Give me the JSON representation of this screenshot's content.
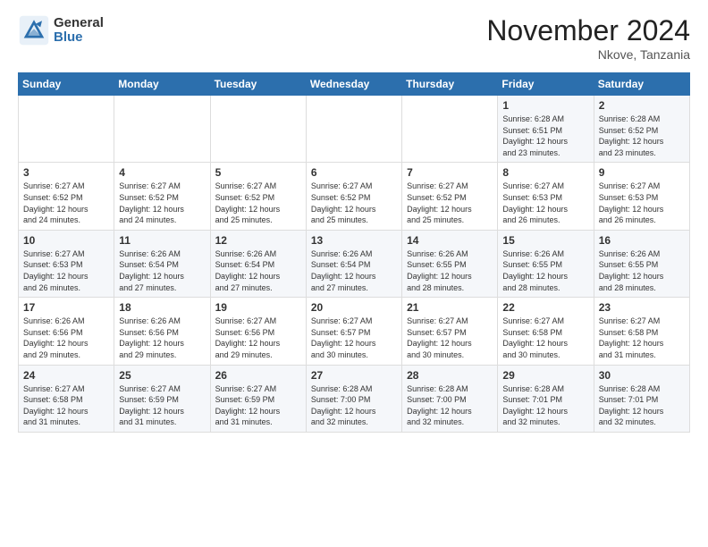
{
  "logo": {
    "general": "General",
    "blue": "Blue"
  },
  "header": {
    "month": "November 2024",
    "location": "Nkove, Tanzania"
  },
  "weekdays": [
    "Sunday",
    "Monday",
    "Tuesday",
    "Wednesday",
    "Thursday",
    "Friday",
    "Saturday"
  ],
  "weeks": [
    [
      {
        "day": "",
        "info": ""
      },
      {
        "day": "",
        "info": ""
      },
      {
        "day": "",
        "info": ""
      },
      {
        "day": "",
        "info": ""
      },
      {
        "day": "",
        "info": ""
      },
      {
        "day": "1",
        "info": "Sunrise: 6:28 AM\nSunset: 6:51 PM\nDaylight: 12 hours\nand 23 minutes."
      },
      {
        "day": "2",
        "info": "Sunrise: 6:28 AM\nSunset: 6:52 PM\nDaylight: 12 hours\nand 23 minutes."
      }
    ],
    [
      {
        "day": "3",
        "info": "Sunrise: 6:27 AM\nSunset: 6:52 PM\nDaylight: 12 hours\nand 24 minutes."
      },
      {
        "day": "4",
        "info": "Sunrise: 6:27 AM\nSunset: 6:52 PM\nDaylight: 12 hours\nand 24 minutes."
      },
      {
        "day": "5",
        "info": "Sunrise: 6:27 AM\nSunset: 6:52 PM\nDaylight: 12 hours\nand 25 minutes."
      },
      {
        "day": "6",
        "info": "Sunrise: 6:27 AM\nSunset: 6:52 PM\nDaylight: 12 hours\nand 25 minutes."
      },
      {
        "day": "7",
        "info": "Sunrise: 6:27 AM\nSunset: 6:52 PM\nDaylight: 12 hours\nand 25 minutes."
      },
      {
        "day": "8",
        "info": "Sunrise: 6:27 AM\nSunset: 6:53 PM\nDaylight: 12 hours\nand 26 minutes."
      },
      {
        "day": "9",
        "info": "Sunrise: 6:27 AM\nSunset: 6:53 PM\nDaylight: 12 hours\nand 26 minutes."
      }
    ],
    [
      {
        "day": "10",
        "info": "Sunrise: 6:27 AM\nSunset: 6:53 PM\nDaylight: 12 hours\nand 26 minutes."
      },
      {
        "day": "11",
        "info": "Sunrise: 6:26 AM\nSunset: 6:54 PM\nDaylight: 12 hours\nand 27 minutes."
      },
      {
        "day": "12",
        "info": "Sunrise: 6:26 AM\nSunset: 6:54 PM\nDaylight: 12 hours\nand 27 minutes."
      },
      {
        "day": "13",
        "info": "Sunrise: 6:26 AM\nSunset: 6:54 PM\nDaylight: 12 hours\nand 27 minutes."
      },
      {
        "day": "14",
        "info": "Sunrise: 6:26 AM\nSunset: 6:55 PM\nDaylight: 12 hours\nand 28 minutes."
      },
      {
        "day": "15",
        "info": "Sunrise: 6:26 AM\nSunset: 6:55 PM\nDaylight: 12 hours\nand 28 minutes."
      },
      {
        "day": "16",
        "info": "Sunrise: 6:26 AM\nSunset: 6:55 PM\nDaylight: 12 hours\nand 28 minutes."
      }
    ],
    [
      {
        "day": "17",
        "info": "Sunrise: 6:26 AM\nSunset: 6:56 PM\nDaylight: 12 hours\nand 29 minutes."
      },
      {
        "day": "18",
        "info": "Sunrise: 6:26 AM\nSunset: 6:56 PM\nDaylight: 12 hours\nand 29 minutes."
      },
      {
        "day": "19",
        "info": "Sunrise: 6:27 AM\nSunset: 6:56 PM\nDaylight: 12 hours\nand 29 minutes."
      },
      {
        "day": "20",
        "info": "Sunrise: 6:27 AM\nSunset: 6:57 PM\nDaylight: 12 hours\nand 30 minutes."
      },
      {
        "day": "21",
        "info": "Sunrise: 6:27 AM\nSunset: 6:57 PM\nDaylight: 12 hours\nand 30 minutes."
      },
      {
        "day": "22",
        "info": "Sunrise: 6:27 AM\nSunset: 6:58 PM\nDaylight: 12 hours\nand 30 minutes."
      },
      {
        "day": "23",
        "info": "Sunrise: 6:27 AM\nSunset: 6:58 PM\nDaylight: 12 hours\nand 31 minutes."
      }
    ],
    [
      {
        "day": "24",
        "info": "Sunrise: 6:27 AM\nSunset: 6:58 PM\nDaylight: 12 hours\nand 31 minutes."
      },
      {
        "day": "25",
        "info": "Sunrise: 6:27 AM\nSunset: 6:59 PM\nDaylight: 12 hours\nand 31 minutes."
      },
      {
        "day": "26",
        "info": "Sunrise: 6:27 AM\nSunset: 6:59 PM\nDaylight: 12 hours\nand 31 minutes."
      },
      {
        "day": "27",
        "info": "Sunrise: 6:28 AM\nSunset: 7:00 PM\nDaylight: 12 hours\nand 32 minutes."
      },
      {
        "day": "28",
        "info": "Sunrise: 6:28 AM\nSunset: 7:00 PM\nDaylight: 12 hours\nand 32 minutes."
      },
      {
        "day": "29",
        "info": "Sunrise: 6:28 AM\nSunset: 7:01 PM\nDaylight: 12 hours\nand 32 minutes."
      },
      {
        "day": "30",
        "info": "Sunrise: 6:28 AM\nSunset: 7:01 PM\nDaylight: 12 hours\nand 32 minutes."
      }
    ]
  ]
}
